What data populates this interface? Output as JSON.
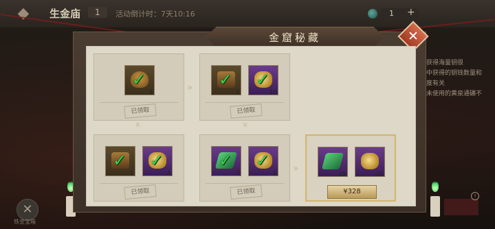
{
  "topbar": {
    "back_icon": "back-arrow-icon",
    "title": "生金庙",
    "count": "1",
    "timer": "活动倒计时：7天10:16",
    "resource_value": "1",
    "plus_label": "+"
  },
  "side_notes": [
    "获得海量钥很",
    "中获得的钥钱数量和",
    "度有关",
    "未使用的黄泉通碾不"
  ],
  "bottom_left": {
    "label": "铁金宝箱",
    "icon": "crossed-swords-icon"
  },
  "modal": {
    "title": "金窟秘藏",
    "close_icon": "close-icon",
    "claimed_label": "已领取",
    "price_label": "¥328",
    "rewards": [
      {
        "items": [
          {
            "art": "bag",
            "qty": "3"
          }
        ],
        "claimed": true
      },
      {
        "items": [
          {
            "art": "chest",
            "qty": "1"
          },
          {
            "art": "coin",
            "qty": "10"
          }
        ],
        "claimed": true
      },
      {
        "items": [
          {
            "art": "chest",
            "qty": "1"
          },
          {
            "art": "coin",
            "qty": "4"
          }
        ],
        "claimed": true
      },
      {
        "items": [
          {
            "art": "token",
            "qty": "3"
          },
          {
            "art": "coin",
            "qty": "2"
          }
        ],
        "claimed": true
      },
      {
        "items": [
          {
            "art": "token",
            "qty": "25"
          },
          {
            "art": "coin",
            "qty": "20"
          }
        ],
        "claimed": false
      }
    ]
  },
  "colors": {
    "accent": "#d2b56e",
    "close": "#b84a30",
    "check": "#39d04a"
  }
}
